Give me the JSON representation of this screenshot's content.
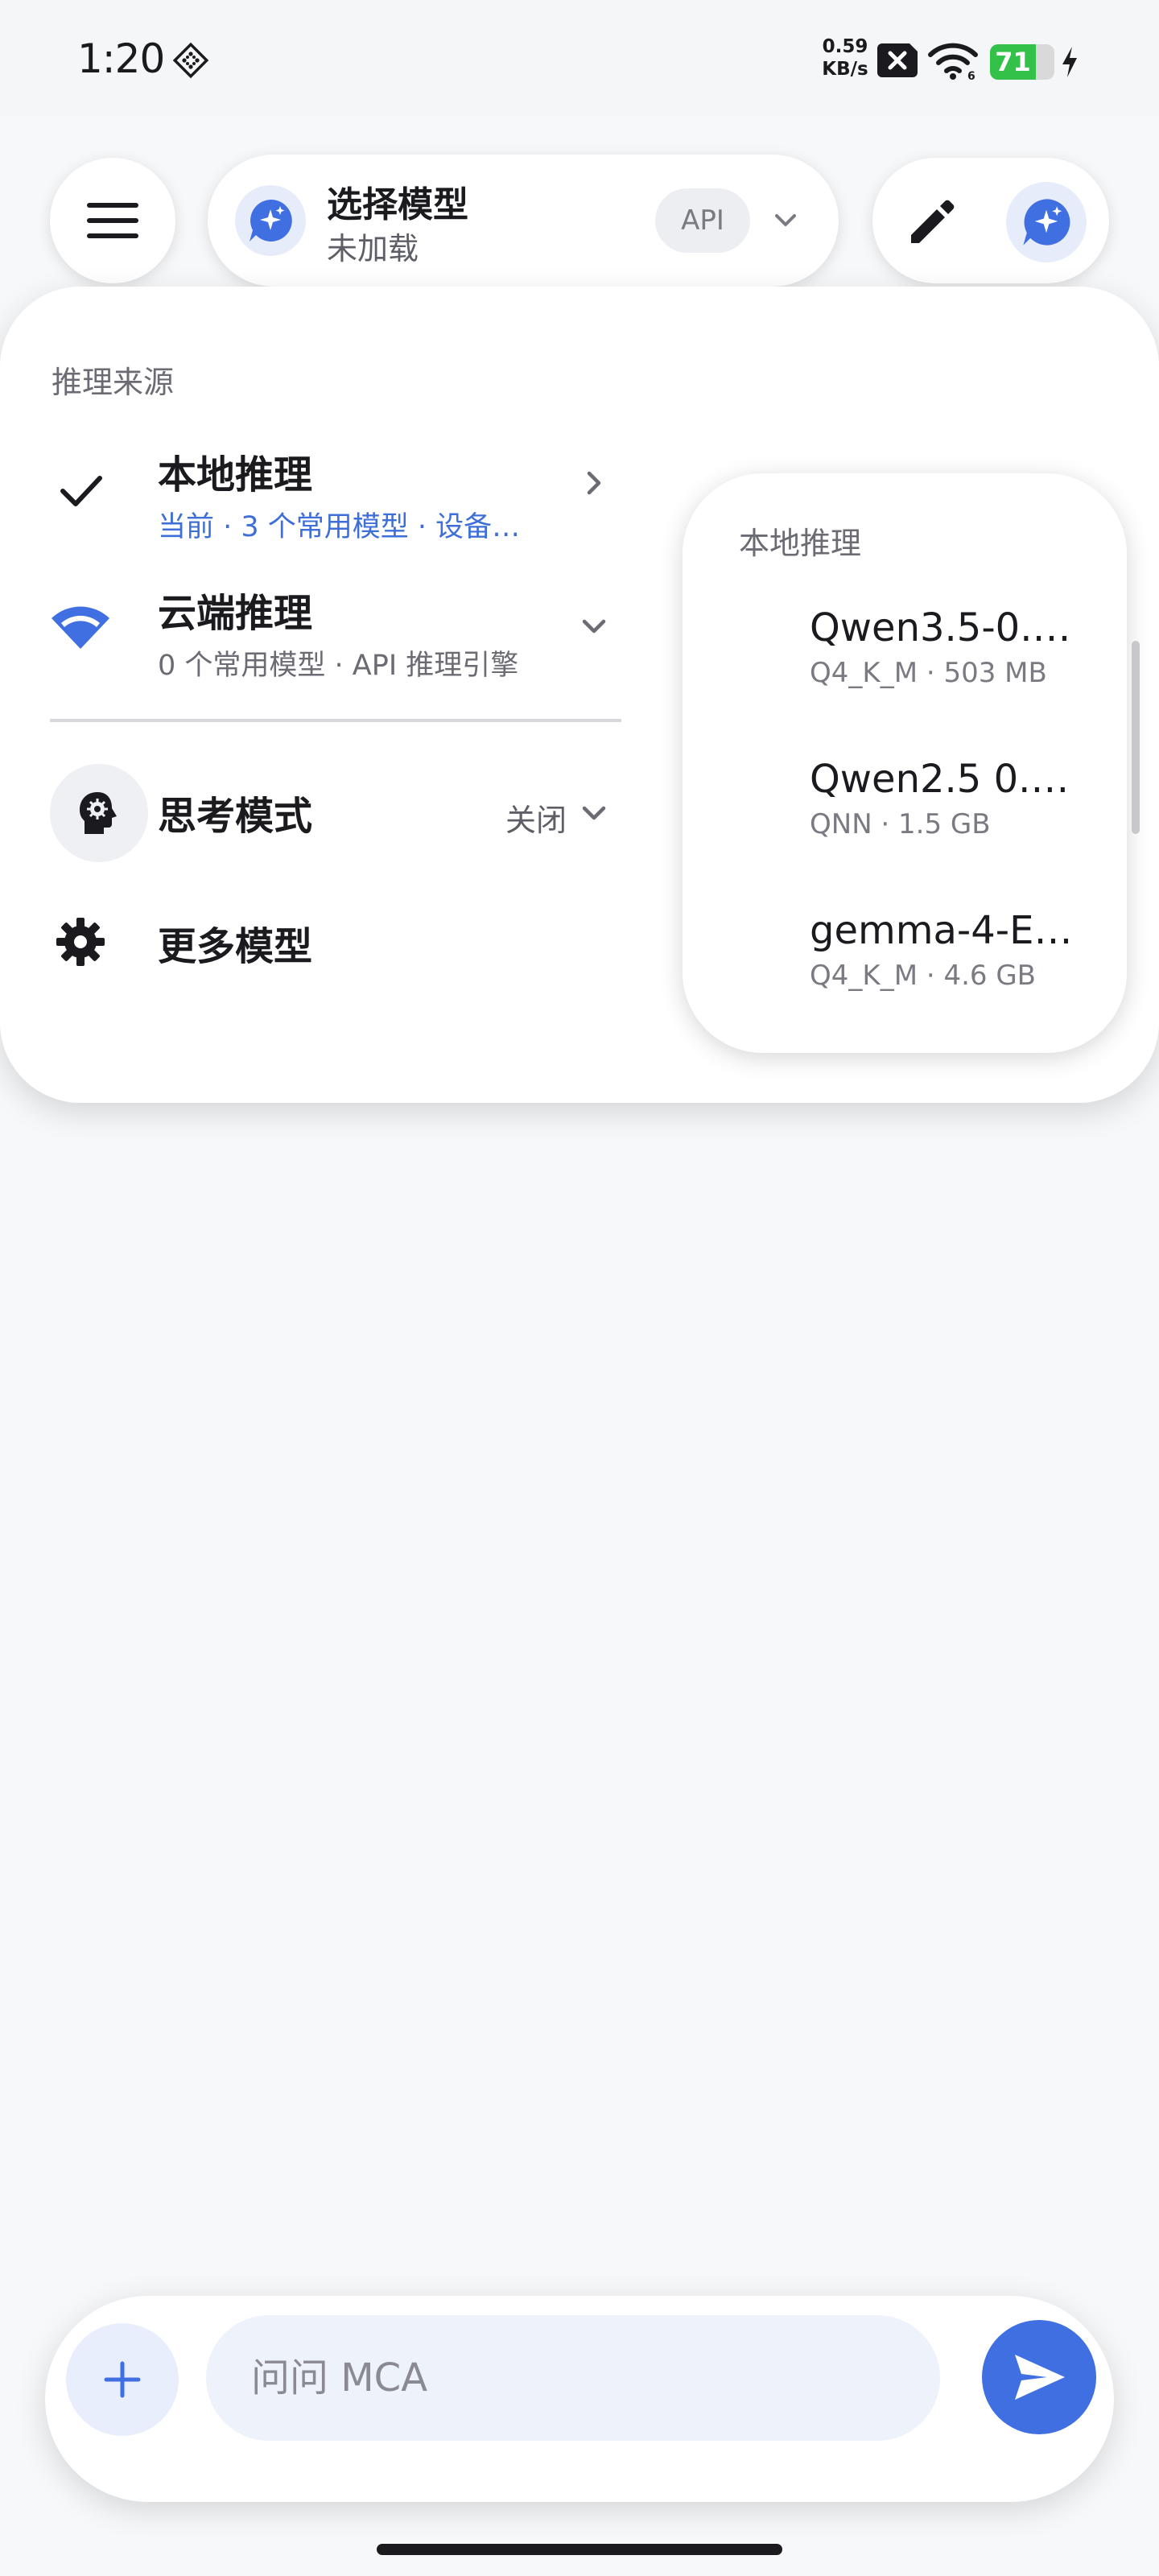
{
  "status_bar": {
    "time": "1:20",
    "net_speed_value": "0.59",
    "net_speed_unit": "KB/s",
    "battery_level": 71,
    "battery_label": "71",
    "icons": [
      "diamond-icon",
      "sim-x-icon",
      "wifi-icon",
      "charging-icon"
    ]
  },
  "app_bar": {
    "menu_icon": "hamburger-icon",
    "model_title": "选择模型",
    "model_subtitle": "未加载",
    "api_badge": "API",
    "edit_icon": "pencil-icon",
    "assistant_icon": "chat-sparkle-icon"
  },
  "dropdown": {
    "section_label": "推理来源",
    "local": {
      "title": "本地推理",
      "subtitle": "当前 · 3 个常用模型 · 设备…",
      "selected": true
    },
    "cloud": {
      "title": "云端推理",
      "subtitle": "0 个常用模型 · API 推理引擎"
    },
    "thinking": {
      "title": "思考模式",
      "status": "关闭"
    },
    "more": {
      "title": "更多模型"
    }
  },
  "submenu": {
    "title": "本地推理",
    "items": [
      {
        "name": "Qwen3.5-0.…",
        "meta": "Q4_K_M · 503 MB"
      },
      {
        "name": "Qwen2.5 0.…",
        "meta": "QNN · 1.5 GB"
      },
      {
        "name": "gemma-4-E…",
        "meta": "Q4_K_M · 4.6 GB"
      }
    ]
  },
  "composer": {
    "placeholder": "问问 MCA",
    "attach_icon": "plus-icon",
    "send_icon": "send-icon"
  },
  "colors": {
    "accent": "#3f6fe0",
    "accent_text": "#3e6fd8",
    "battery": "#33c14a",
    "background": "#f7f8fa"
  }
}
